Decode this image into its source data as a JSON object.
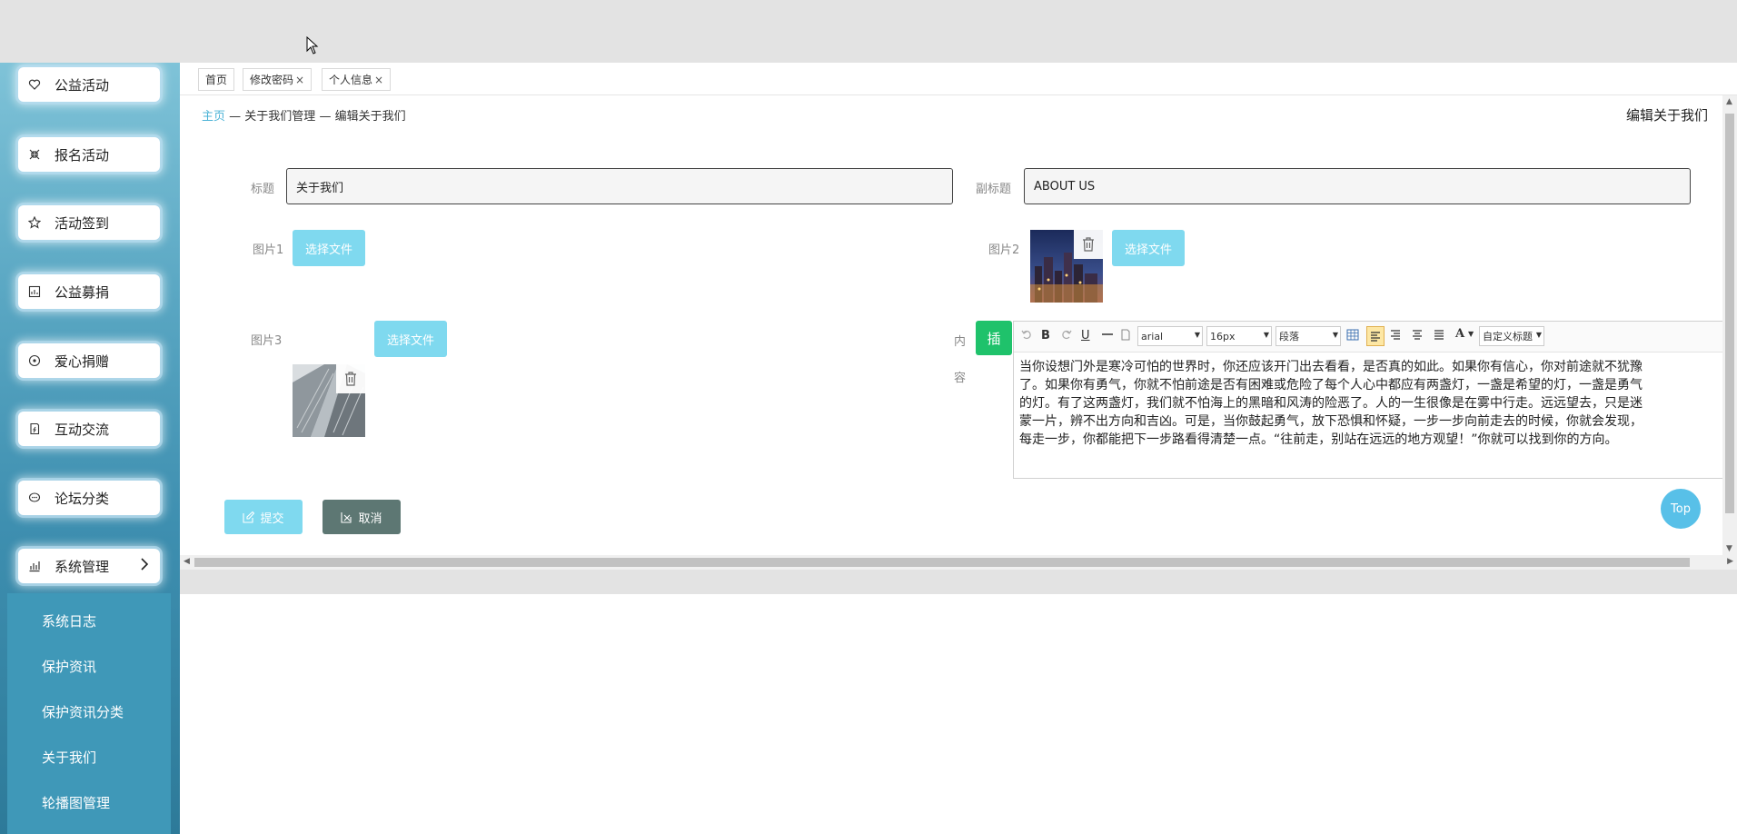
{
  "sidebar": {
    "items": [
      {
        "label": "公益活动",
        "icon": "heart-hand-icon"
      },
      {
        "label": "报名活动",
        "icon": "shrink-icon"
      },
      {
        "label": "活动签到",
        "icon": "star-icon"
      },
      {
        "label": "公益募捐",
        "icon": "chart-icon"
      },
      {
        "label": "爱心捐赠",
        "icon": "circle-dot-icon"
      },
      {
        "label": "互动交流",
        "icon": "doc-icon"
      },
      {
        "label": "论坛分类",
        "icon": "chat-icon"
      },
      {
        "label": "系统管理",
        "icon": "bar-chart-icon"
      }
    ],
    "sub_items": [
      "系统日志",
      "保护资讯",
      "保护资讯分类",
      "关于我们",
      "轮播图管理"
    ]
  },
  "tabs": [
    {
      "label": "首页",
      "closable": false
    },
    {
      "label": "修改密码",
      "closable": true
    },
    {
      "label": "个人信息",
      "closable": true
    }
  ],
  "tab_close": "×",
  "breadcrumb": {
    "home": "主页",
    "sep": "—",
    "level1": "关于我们管理",
    "level2": "编辑关于我们"
  },
  "page_title": "编辑关于我们",
  "form": {
    "title_label": "标题",
    "title_value": "关于我们",
    "subtitle_label": "副标题",
    "subtitle_value": "ABOUT US",
    "pic1_label": "图片1",
    "pic2_label": "图片2",
    "pic3_label": "图片3",
    "choose_file": "选择文件",
    "content_label_1": "内",
    "content_label_2": "容",
    "insert_label": "插"
  },
  "editor": {
    "font_family": "arial",
    "font_size": "16px",
    "paragraph": "段落",
    "custom_heading": "自定义标题",
    "content_lines": [
      "当你设想门外是寒冷可怕的世界时，你还应该开门出去看看，是否真的如此。如果你有信心，你对前途就不犹豫",
      "了。如果你有勇气，你就不怕前途是否有困难或危险了每个人心中都应有两盏灯，一盏是希望的灯，一盏是勇气",
      "的灯。有了这两盏灯，我们就不怕海上的黑暗和风涛的险恶了。人的一生很像是在雾中行走。远远望去，只是迷",
      "蒙一片，辨不出方向和吉凶。可是，当你鼓起勇气，放下恐惧和怀疑，一步一步向前走去的时候，你就会发现，",
      "每走一步，你都能把下一步路看得清楚一点。“往前走，别站在远远的地方观望！”你就可以找到你的方向。"
    ]
  },
  "buttons": {
    "submit": "提交",
    "cancel": "取消",
    "top": "Top"
  },
  "colors": {
    "accent": "#7fd9ef",
    "cancel": "#5d7773",
    "insert": "#1fc26b",
    "link": "#4bb3d6"
  }
}
